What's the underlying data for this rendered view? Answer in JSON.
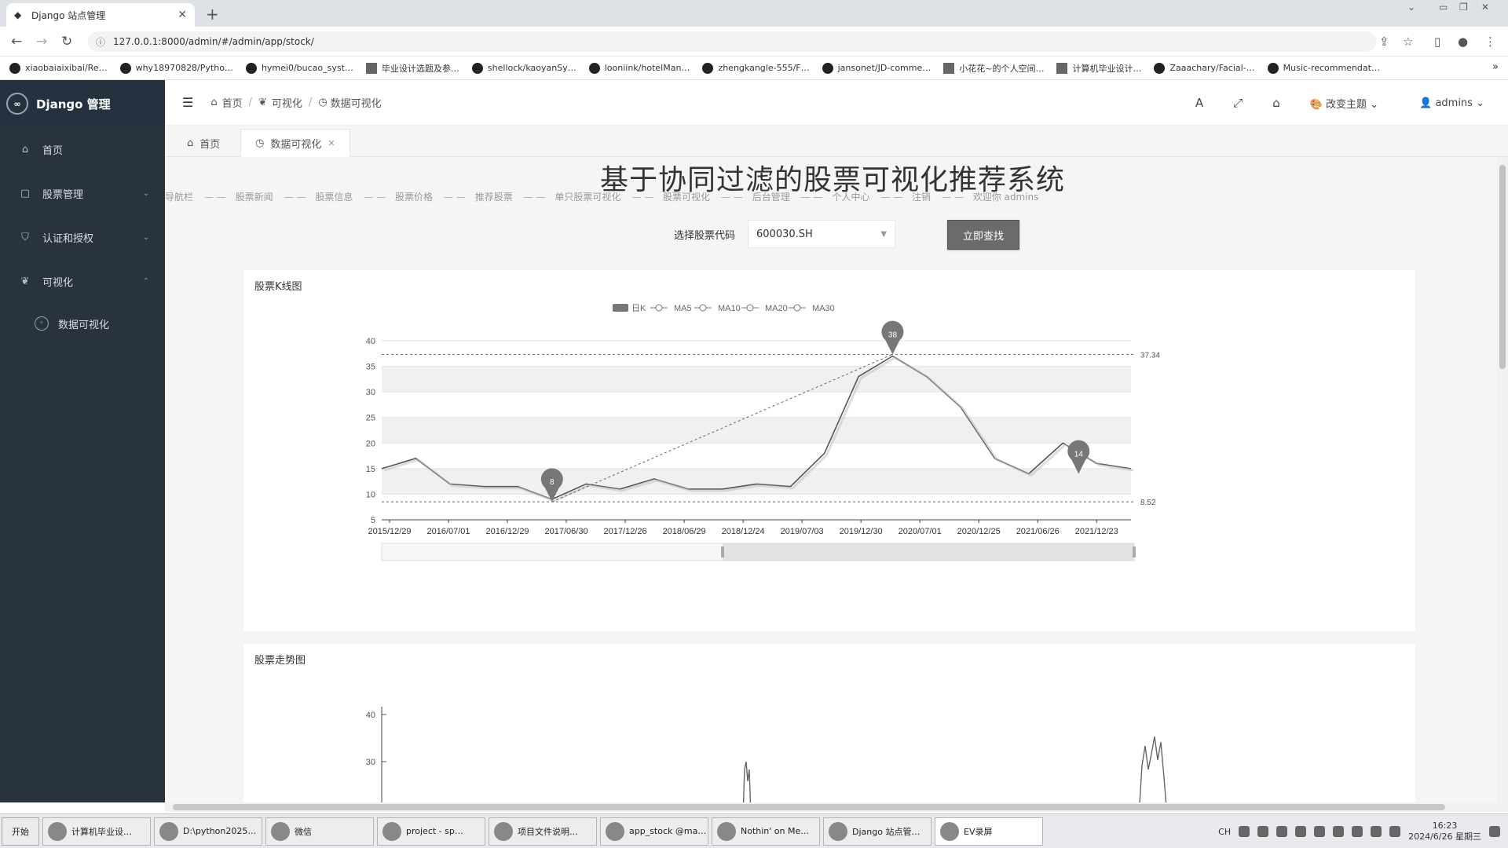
{
  "browser": {
    "tab_title": "Django 站点管理",
    "url": "127.0.0.1:8000/admin/#/admin/app/stock/",
    "bookmarks": [
      "xiaobaiaixibai/Re…",
      "why18970828/Pytho…",
      "hymei0/bucao_syst…",
      "毕业设计选题及参…",
      "shellock/kaoyanSy…",
      "looniink/hotelMan…",
      "zhengkangle-555/F…",
      "jansonet/JD-comme…",
      "小花花~的个人空间…",
      "计算机毕业设计…",
      "Zaaachary/Facial-…",
      "Music-recommendat…"
    ]
  },
  "sidebar": {
    "brand": "Django 管理",
    "items": [
      {
        "label": "首页",
        "icon": "home-icon"
      },
      {
        "label": "股票管理",
        "icon": "file-icon"
      },
      {
        "label": "认证和授权",
        "icon": "shield-icon"
      },
      {
        "label": "可视化",
        "icon": "leaf-icon"
      }
    ],
    "sub_item": "数据可视化"
  },
  "topbar": {
    "breadcrumbs": [
      "首页",
      "可视化",
      "数据可视化"
    ],
    "theme_label": "改变主题",
    "user": "admins"
  },
  "page_tabs": [
    "首页",
    "数据可视化"
  ],
  "page": {
    "title": "基于协同过滤的股票可视化推荐系统",
    "nav_links": [
      "导航栏",
      "股票新闻",
      "股票信息",
      "股票价格",
      "推荐股票",
      "单只股票可视化",
      "股票可视化",
      "后台管理",
      "个人中心",
      "注销",
      "欢迎你 admins"
    ],
    "select_label": "选择股票代码",
    "selected_code": "600030.SH",
    "search_button": "立即查找"
  },
  "chart_data": [
    {
      "type": "line",
      "title": "股票K线图",
      "legend": [
        "日K",
        "MA5",
        "MA10",
        "MA20",
        "MA30"
      ],
      "legend_position": "top-center",
      "categories": [
        "2015/12/29",
        "2016/07/01",
        "2016/12/29",
        "2017/06/30",
        "2017/12/26",
        "2018/06/29",
        "2018/12/24",
        "2019/07/03",
        "2019/12/30",
        "2020/07/01",
        "2020/12/25",
        "2021/06/26",
        "2021/12/23"
      ],
      "series": [
        {
          "name": "日K",
          "values": [
            15,
            17,
            12,
            11.5,
            11.5,
            9,
            12,
            11,
            13,
            11,
            11,
            12,
            11.5,
            18,
            33,
            37,
            33,
            27,
            17,
            14,
            20,
            16,
            15
          ]
        }
      ],
      "ylim": [
        5,
        40
      ],
      "yticks": [
        5,
        10,
        15,
        20,
        25,
        30,
        35,
        40
      ],
      "markers": [
        {
          "label": "38",
          "value": 37.34
        },
        {
          "label": "8",
          "value": 8.52
        },
        {
          "label": "14",
          "value": 14
        }
      ],
      "reference_lines": [
        37.34,
        8.52
      ],
      "grid": true
    },
    {
      "type": "line",
      "title": "股票走势图",
      "yticks": [
        30,
        40
      ],
      "grid": false
    }
  ],
  "taskbar": {
    "start": "开始",
    "tasks": [
      "计算机毕业设…",
      "D:\\python2025…",
      "微信",
      "project - sp…",
      "项目文件说明…",
      "app_stock @ma…",
      "Nothin' on Me…",
      "Django 站点管…",
      "EV录屏"
    ],
    "lang": "CH",
    "time": "16:23",
    "date": "2024/6/26 星期三"
  }
}
